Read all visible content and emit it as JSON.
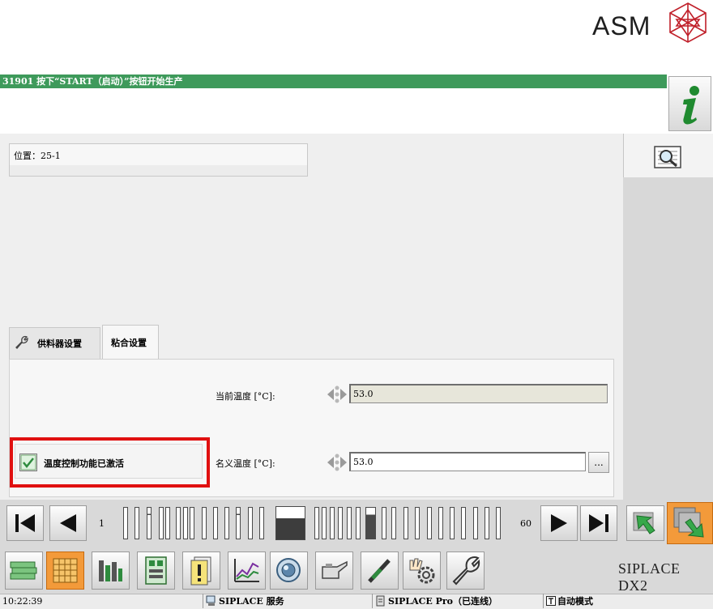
{
  "brand": {
    "logo_text": "ASM"
  },
  "message_bar": {
    "text": "31901 按下“START（启动）”按钮开始生产"
  },
  "position": {
    "label": "位置：25-1"
  },
  "tabs": [
    {
      "label": "供料器设置",
      "icon": "wrench-icon",
      "active": false
    },
    {
      "label": "粘合设置",
      "active": true
    }
  ],
  "fields": {
    "current_temp": {
      "label": "当前温度 [°C]:",
      "value": "53.0"
    },
    "nominal_temp": {
      "label": "名义温度 [°C]:",
      "value": "53.0",
      "button_label": "..."
    }
  },
  "temp_control": {
    "label": "温度控制功能已激活",
    "checked": true
  },
  "pager": {
    "first_page": "1",
    "last_page": "60"
  },
  "toolbar": {
    "model": "SIPLACE DX2",
    "buttons": [
      "stack-icon",
      "grid-icon",
      "bars-icon",
      "board-icon",
      "warning-icon",
      "chart-icon",
      "camera-icon",
      "oil-can-icon",
      "nozzle-icon",
      "hand-gear-icon",
      "wrench-icon"
    ]
  },
  "statusbar": {
    "time": "10:22:39",
    "service": "SIPLACE 服务",
    "pro": "SIPLACE Pro（已连线）",
    "mode": "自动模式"
  },
  "colors": {
    "message_bar": "#3e9a5b",
    "active_toolbar": "#f39a3a",
    "highlight_frame": "#e01010"
  }
}
